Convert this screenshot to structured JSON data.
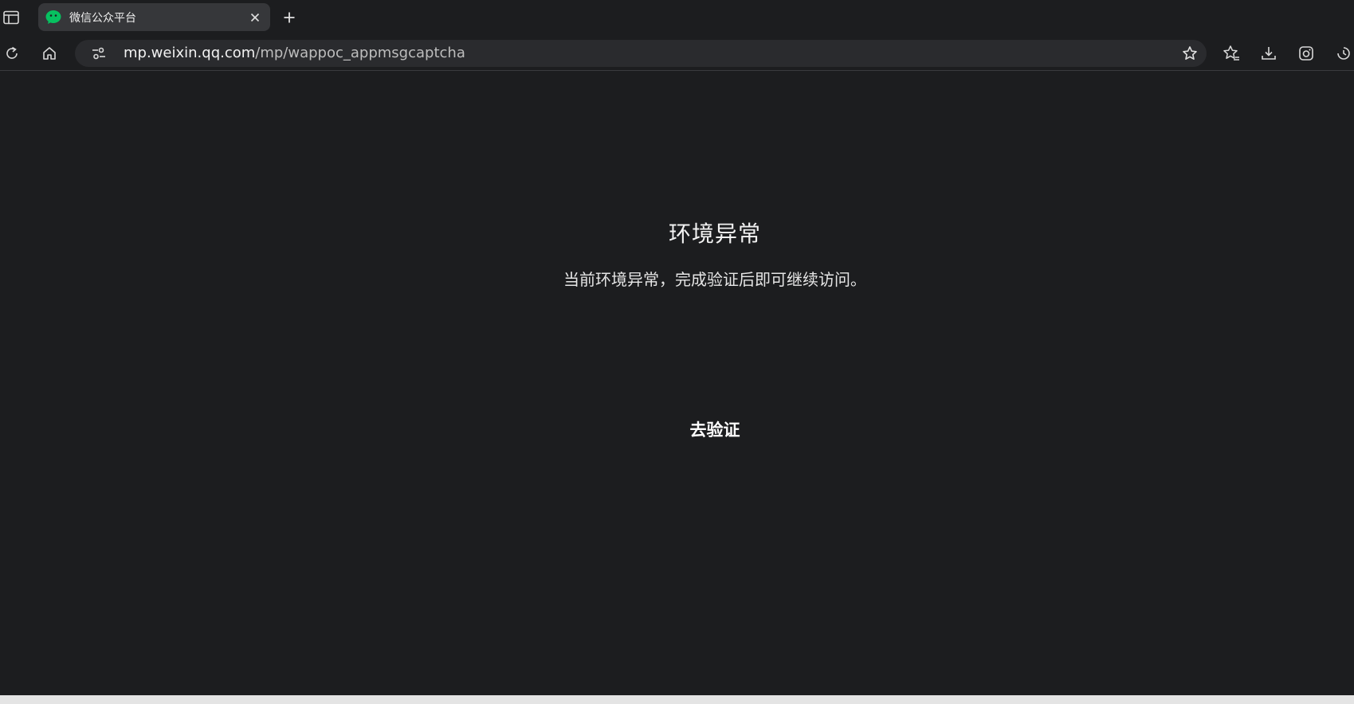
{
  "browser": {
    "tab": {
      "title": "微信公众平台",
      "favicon": "wechat-icon",
      "favicon_color": "#07c160"
    },
    "address_bar": {
      "host": "mp.weixin.qq.com",
      "path": "/mp/wappoc_appmsgcaptcha"
    },
    "toolbar_icons": [
      "reload-icon",
      "home-icon",
      "site-info-icon",
      "favorite-star-icon",
      "favorites-icon",
      "downloads-icon",
      "screenshot-icon",
      "history-icon"
    ]
  },
  "page": {
    "title": "环境异常",
    "description": "当前环境异常，完成验证后即可继续访问。",
    "verify_button_label": "去验证"
  },
  "colors": {
    "background": "#1c1d1f",
    "tab_active": "#36373a",
    "address_bar": "#2a2b2e"
  }
}
